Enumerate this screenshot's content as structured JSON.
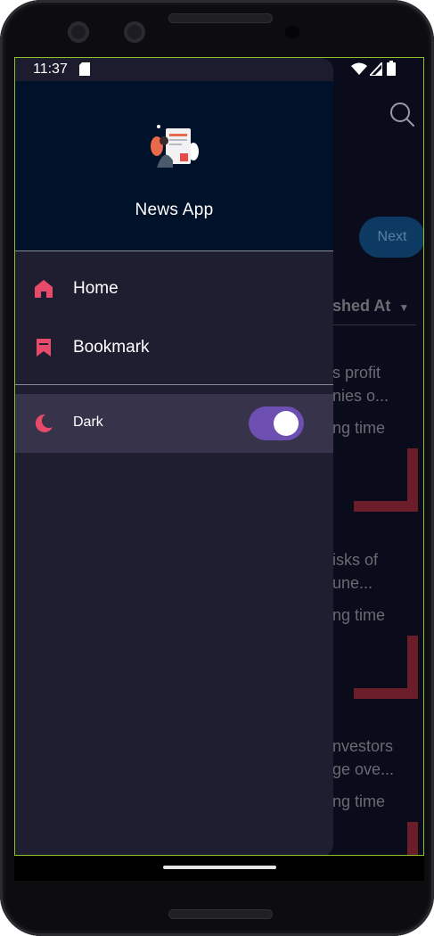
{
  "status_bar": {
    "time": "11:37",
    "icons": [
      "sd-card-icon",
      "wifi-icon",
      "signal-icon",
      "battery-icon"
    ]
  },
  "drawer": {
    "app_title": "News App",
    "menu": [
      {
        "label": "Home",
        "icon": "home-icon"
      },
      {
        "label": "Bookmark",
        "icon": "bookmark-icon"
      }
    ],
    "dark_mode": {
      "label": "Dark",
      "icon": "moon-icon",
      "enabled": true
    }
  },
  "background": {
    "search_icon": "search-icon",
    "next_button": "Next",
    "sort_label": "shed At",
    "articles": [
      {
        "line1": "s  profit",
        "line2": "nies o...",
        "line3": "ng time"
      },
      {
        "line1": "isks   of",
        "line2": "une...",
        "line3": "ng time"
      },
      {
        "line1": "nvestors",
        "line2": "ge ove...",
        "line3": "ng time"
      }
    ]
  },
  "colors": {
    "accent": "#e84a6a",
    "drawer_bg": "#1f1d30",
    "header_bg": "#00112a",
    "toggle_on": "#6c4fb0",
    "selected_row": "#36334a"
  }
}
